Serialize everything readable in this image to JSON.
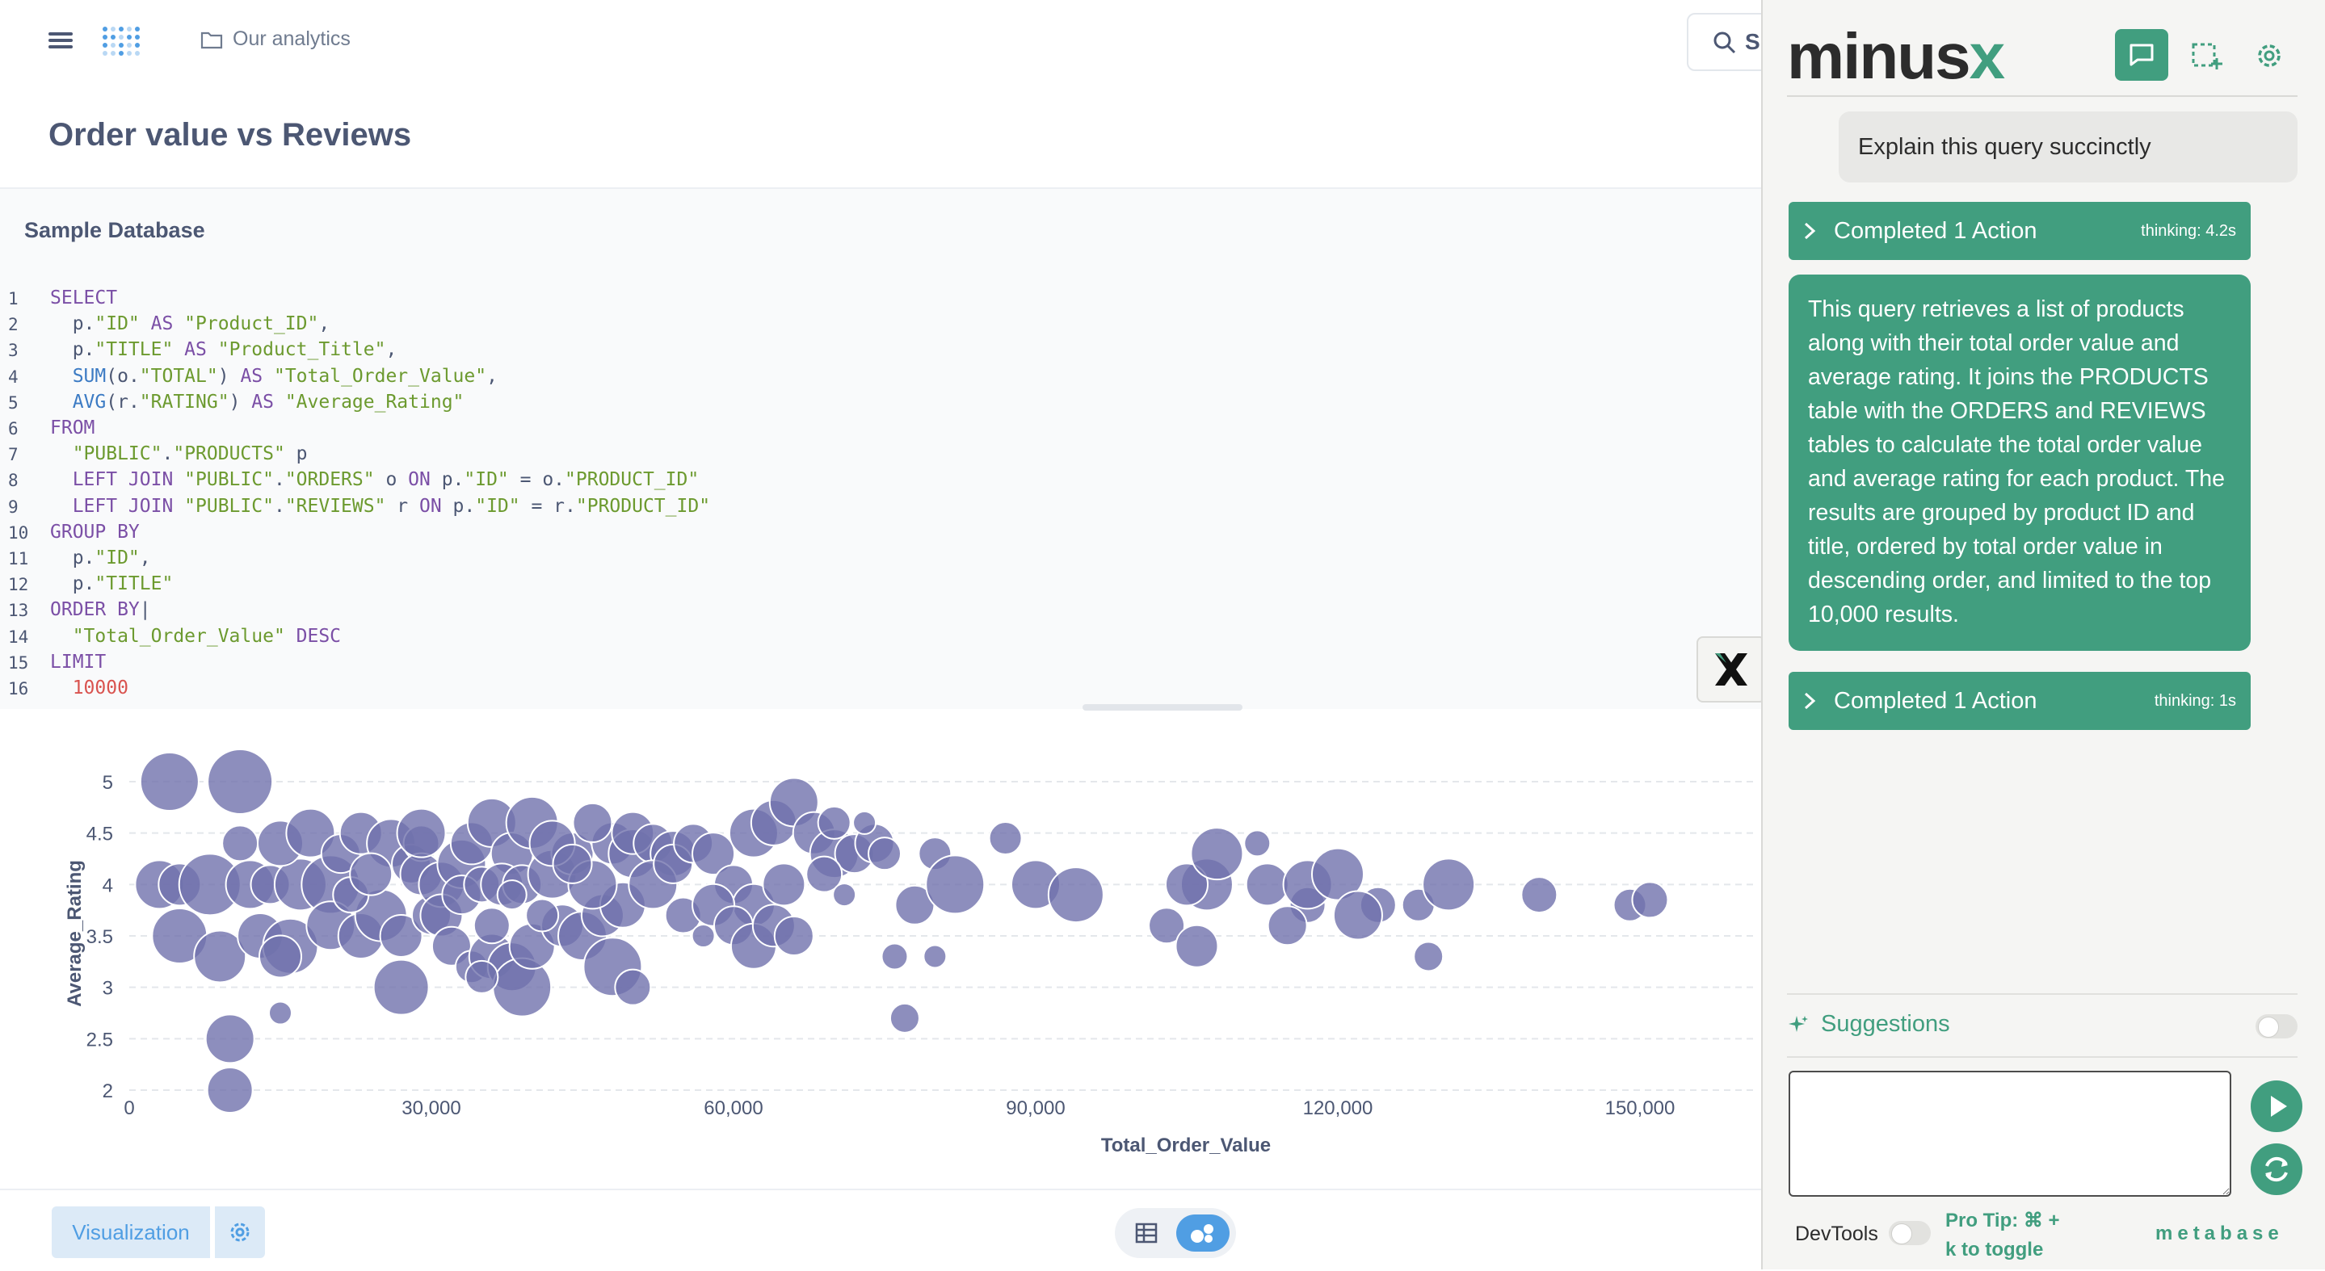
{
  "topbar": {
    "breadcrumb": "Our analytics",
    "search_partial": "S"
  },
  "page_title": "Order value vs Reviews",
  "database": "Sample Database",
  "sql_lines": [
    {
      "n": "1",
      "t": [
        [
          "kw",
          "SELECT"
        ]
      ]
    },
    {
      "n": "2",
      "t": [
        [
          "id",
          "  p."
        ],
        [
          "str",
          "\"ID\""
        ],
        [
          "kw",
          " AS "
        ],
        [
          "str",
          "\"Product_ID\""
        ],
        [
          "id",
          ","
        ]
      ]
    },
    {
      "n": "3",
      "t": [
        [
          "id",
          "  p."
        ],
        [
          "str",
          "\"TITLE\""
        ],
        [
          "kw",
          " AS "
        ],
        [
          "str",
          "\"Product_Title\""
        ],
        [
          "id",
          ","
        ]
      ]
    },
    {
      "n": "4",
      "t": [
        [
          "fn",
          "  SUM"
        ],
        [
          "id",
          "(o."
        ],
        [
          "str",
          "\"TOTAL\""
        ],
        [
          "id",
          ")"
        ],
        [
          "kw",
          " AS "
        ],
        [
          "str",
          "\"Total_Order_Value\""
        ],
        [
          "id",
          ","
        ]
      ]
    },
    {
      "n": "5",
      "t": [
        [
          "fn",
          "  AVG"
        ],
        [
          "id",
          "(r."
        ],
        [
          "str",
          "\"RATING\""
        ],
        [
          "id",
          ")"
        ],
        [
          "kw",
          " AS "
        ],
        [
          "str",
          "\"Average_Rating\""
        ]
      ]
    },
    {
      "n": "6",
      "t": [
        [
          "kw",
          "FROM"
        ]
      ]
    },
    {
      "n": "7",
      "t": [
        [
          "str",
          "  \"PUBLIC\""
        ],
        [
          "id",
          "."
        ],
        [
          "str",
          "\"PRODUCTS\""
        ],
        [
          "id",
          " p"
        ]
      ]
    },
    {
      "n": "8",
      "t": [
        [
          "kw",
          "  LEFT JOIN "
        ],
        [
          "str",
          "\"PUBLIC\""
        ],
        [
          "id",
          "."
        ],
        [
          "str",
          "\"ORDERS\""
        ],
        [
          "id",
          " o "
        ],
        [
          "kw",
          "ON"
        ],
        [
          "id",
          " p."
        ],
        [
          "str",
          "\"ID\""
        ],
        [
          "id",
          " = o."
        ],
        [
          "str",
          "\"PRODUCT_ID\""
        ]
      ]
    },
    {
      "n": "9",
      "t": [
        [
          "kw",
          "  LEFT JOIN "
        ],
        [
          "str",
          "\"PUBLIC\""
        ],
        [
          "id",
          "."
        ],
        [
          "str",
          "\"REVIEWS\""
        ],
        [
          "id",
          " r "
        ],
        [
          "kw",
          "ON"
        ],
        [
          "id",
          " p."
        ],
        [
          "str",
          "\"ID\""
        ],
        [
          "id",
          " = r."
        ],
        [
          "str",
          "\"PRODUCT_ID\""
        ]
      ]
    },
    {
      "n": "10",
      "t": [
        [
          "kw",
          "GROUP BY"
        ]
      ]
    },
    {
      "n": "11",
      "t": [
        [
          "id",
          "  p."
        ],
        [
          "str",
          "\"ID\""
        ],
        [
          "id",
          ","
        ]
      ]
    },
    {
      "n": "12",
      "t": [
        [
          "id",
          "  p."
        ],
        [
          "str",
          "\"TITLE\""
        ]
      ]
    },
    {
      "n": "13",
      "t": [
        [
          "kw",
          "ORDER BY"
        ],
        [
          "id",
          "|"
        ]
      ]
    },
    {
      "n": "14",
      "t": [
        [
          "str",
          "  \"Total_Order_Value\""
        ],
        [
          "kw",
          " DESC"
        ]
      ]
    },
    {
      "n": "15",
      "t": [
        [
          "kw",
          "LIMIT"
        ]
      ]
    },
    {
      "n": "16",
      "t": [
        [
          "num",
          "  10000"
        ]
      ]
    }
  ],
  "chart_data": {
    "type": "scatter",
    "xlabel": "Total_Order_Value",
    "ylabel": "Average_Rating",
    "xlim": [
      0,
      160000
    ],
    "ylim": [
      2,
      5
    ],
    "x_ticks": [
      "0",
      "30,000",
      "60,000",
      "90,000",
      "120,000",
      "150,000"
    ],
    "y_ticks": [
      "2",
      "2.5",
      "3",
      "3.5",
      "4",
      "4.5",
      "5"
    ],
    "color": "#7172ad",
    "points": [
      [
        4000,
        5,
        36
      ],
      [
        11000,
        5,
        40
      ],
      [
        3000,
        4,
        30
      ],
      [
        5000,
        4,
        26
      ],
      [
        8000,
        4,
        38
      ],
      [
        12000,
        4,
        30
      ],
      [
        14000,
        4,
        24
      ],
      [
        17000,
        4,
        32
      ],
      [
        20000,
        4,
        36
      ],
      [
        5000,
        3.5,
        34
      ],
      [
        9000,
        3.3,
        32
      ],
      [
        13000,
        3.5,
        28
      ],
      [
        16000,
        3.4,
        34
      ],
      [
        15000,
        3.3,
        26
      ],
      [
        10000,
        2.5,
        30
      ],
      [
        10000,
        2,
        28
      ],
      [
        15000,
        2.75,
        14
      ],
      [
        11000,
        4.4,
        22
      ],
      [
        15000,
        4.4,
        28
      ],
      [
        18000,
        4.5,
        30
      ],
      [
        21000,
        4.3,
        24
      ],
      [
        23000,
        4.5,
        26
      ],
      [
        26000,
        4.4,
        30
      ],
      [
        28000,
        4.2,
        24
      ],
      [
        29000,
        4.4,
        22
      ],
      [
        20000,
        3.6,
        30
      ],
      [
        23000,
        3.5,
        28
      ],
      [
        25000,
        3.7,
        32
      ],
      [
        27000,
        3.5,
        26
      ],
      [
        30000,
        3.7,
        24
      ],
      [
        22000,
        3.9,
        22
      ],
      [
        24000,
        4.1,
        26
      ],
      [
        29000,
        4.1,
        26
      ],
      [
        31000,
        4,
        28
      ],
      [
        33000,
        4.2,
        30
      ],
      [
        34000,
        4.4,
        26
      ],
      [
        29000,
        4.5,
        30
      ],
      [
        36000,
        4.6,
        30
      ],
      [
        38000,
        4.3,
        26
      ],
      [
        31000,
        3.7,
        26
      ],
      [
        33000,
        3.9,
        24
      ],
      [
        35000,
        4,
        22
      ],
      [
        37000,
        4,
        26
      ],
      [
        39000,
        4,
        24
      ],
      [
        42000,
        4.1,
        30
      ],
      [
        44000,
        4.3,
        26
      ],
      [
        32000,
        3.4,
        24
      ],
      [
        34000,
        3.2,
        20
      ],
      [
        36000,
        3.3,
        28
      ],
      [
        38000,
        3.2,
        30
      ],
      [
        39000,
        3,
        36
      ],
      [
        27000,
        3,
        34
      ],
      [
        40000,
        3.4,
        28
      ],
      [
        43000,
        3.6,
        26
      ],
      [
        45000,
        3.5,
        30
      ],
      [
        47000,
        3.7,
        26
      ],
      [
        49000,
        3.8,
        28
      ],
      [
        46000,
        4,
        30
      ],
      [
        48000,
        4.4,
        26
      ],
      [
        50000,
        4.3,
        30
      ],
      [
        40000,
        4.6,
        32
      ],
      [
        42000,
        4.4,
        28
      ],
      [
        44000,
        4.2,
        24
      ],
      [
        46000,
        4.6,
        24
      ],
      [
        50000,
        4.5,
        26
      ],
      [
        52000,
        4.4,
        24
      ],
      [
        54000,
        4.3,
        28
      ],
      [
        52000,
        4,
        30
      ],
      [
        54000,
        4.2,
        24
      ],
      [
        56000,
        4.4,
        24
      ],
      [
        58000,
        4.3,
        26
      ],
      [
        60000,
        4,
        24
      ],
      [
        62000,
        3.8,
        26
      ],
      [
        65000,
        4,
        26
      ],
      [
        55000,
        3.7,
        22
      ],
      [
        58000,
        3.8,
        26
      ],
      [
        60000,
        3.6,
        24
      ],
      [
        62000,
        3.4,
        28
      ],
      [
        64000,
        3.6,
        26
      ],
      [
        66000,
        3.5,
        24
      ],
      [
        57000,
        3.5,
        14
      ],
      [
        48000,
        3.2,
        36
      ],
      [
        50000,
        3,
        22
      ],
      [
        36000,
        3.6,
        22
      ],
      [
        35000,
        3.1,
        20
      ],
      [
        41000,
        3.7,
        20
      ],
      [
        38000,
        3.9,
        18
      ],
      [
        62000,
        4.5,
        30
      ],
      [
        64000,
        4.6,
        28
      ],
      [
        66000,
        4.8,
        30
      ],
      [
        68000,
        4.5,
        26
      ],
      [
        70000,
        4.3,
        30
      ],
      [
        72000,
        4.3,
        24
      ],
      [
        74000,
        4.4,
        24
      ],
      [
        69000,
        4.1,
        22
      ],
      [
        71000,
        3.9,
        14
      ],
      [
        70000,
        4.6,
        20
      ],
      [
        73000,
        4.6,
        14
      ],
      [
        75000,
        4.3,
        20
      ],
      [
        80000,
        4.3,
        20
      ],
      [
        78000,
        3.8,
        24
      ],
      [
        82000,
        4,
        36
      ],
      [
        87000,
        4.45,
        20
      ],
      [
        90000,
        4,
        30
      ],
      [
        94000,
        3.9,
        34
      ],
      [
        80000,
        3.3,
        14
      ],
      [
        76000,
        3.3,
        16
      ],
      [
        77000,
        2.7,
        18
      ],
      [
        103000,
        3.6,
        22
      ],
      [
        106000,
        3.4,
        26
      ],
      [
        107000,
        4,
        32
      ],
      [
        105000,
        4,
        26
      ],
      [
        108000,
        4.3,
        32
      ],
      [
        112000,
        4.4,
        16
      ],
      [
        113000,
        4,
        26
      ],
      [
        117000,
        3.8,
        22
      ],
      [
        115000,
        3.6,
        24
      ],
      [
        117000,
        4,
        30
      ],
      [
        120000,
        4.1,
        32
      ],
      [
        124000,
        3.8,
        22
      ],
      [
        122000,
        3.7,
        30
      ],
      [
        128000,
        3.8,
        20
      ],
      [
        131000,
        4,
        32
      ],
      [
        129000,
        3.3,
        18
      ],
      [
        140000,
        3.9,
        22
      ],
      [
        149000,
        3.8,
        20
      ],
      [
        151000,
        3.85,
        22
      ]
    ]
  },
  "bottombar": {
    "visualization": "Visualization"
  },
  "panel": {
    "brand": "minus",
    "brand_x": "x",
    "user_message": "Explain this query succinctly",
    "actions": [
      {
        "label": "Completed 1 Action",
        "thinking": "thinking: 4.2s"
      },
      {
        "label": "Completed 1 Action",
        "thinking": "thinking: 1s"
      }
    ],
    "assistant_message": "This query retrieves a list of products along with their total order value and average rating. It joins the PRODUCTS table with the ORDERS and REVIEWS tables to calculate the total order value and average rating for each product. The results are grouped by product ID and title, ordered by total order value in descending order, and limited to the top 10,000 results.",
    "suggestions": "Suggestions",
    "input_placeholder": "",
    "devtools": "DevTools",
    "protip": "Pro Tip: ⌘ + k to toggle",
    "app_word": "metabase",
    "accent": "#419e7f"
  }
}
